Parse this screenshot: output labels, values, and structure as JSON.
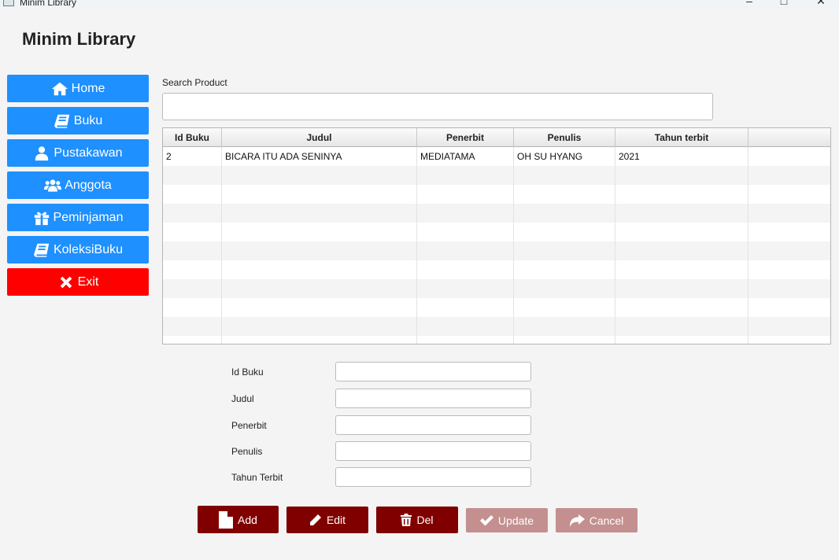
{
  "window": {
    "title": "Minim Library"
  },
  "app": {
    "title": "Minim Library"
  },
  "sidebar": {
    "items": [
      {
        "label": "Home",
        "icon": "home-icon"
      },
      {
        "label": "Buku",
        "icon": "book-icon"
      },
      {
        "label": "Pustakawan",
        "icon": "user-icon"
      },
      {
        "label": "Anggota",
        "icon": "users-icon"
      },
      {
        "label": "Peminjaman",
        "icon": "gift-icon"
      },
      {
        "label": "KoleksiBuku",
        "icon": "book-icon"
      },
      {
        "label": "Exit",
        "icon": "close-icon"
      }
    ]
  },
  "search": {
    "label": "Search Product",
    "value": ""
  },
  "table": {
    "columns": [
      "Id Buku",
      "Judul",
      "Penerbit",
      "Penulis",
      "Tahun terbit"
    ],
    "rows": [
      [
        "2",
        "BICARA ITU ADA SENINYA",
        "MEDIATAMA",
        "OH SU HYANG",
        "2021"
      ]
    ]
  },
  "form": {
    "fields": [
      {
        "label": "Id Buku",
        "value": ""
      },
      {
        "label": "Judul",
        "value": ""
      },
      {
        "label": "Penerbit",
        "value": ""
      },
      {
        "label": "Penulis",
        "value": ""
      },
      {
        "label": "Tahun Terbit",
        "value": ""
      }
    ]
  },
  "actions": {
    "add": "Add",
    "edit": "Edit",
    "del": "Del",
    "update": "Update",
    "cancel": "Cancel"
  },
  "colors": {
    "sidebar_button": "#1e90ff",
    "exit_button": "#ff0000",
    "action_button": "#800000",
    "action_button_disabled": "#c48f8f"
  }
}
